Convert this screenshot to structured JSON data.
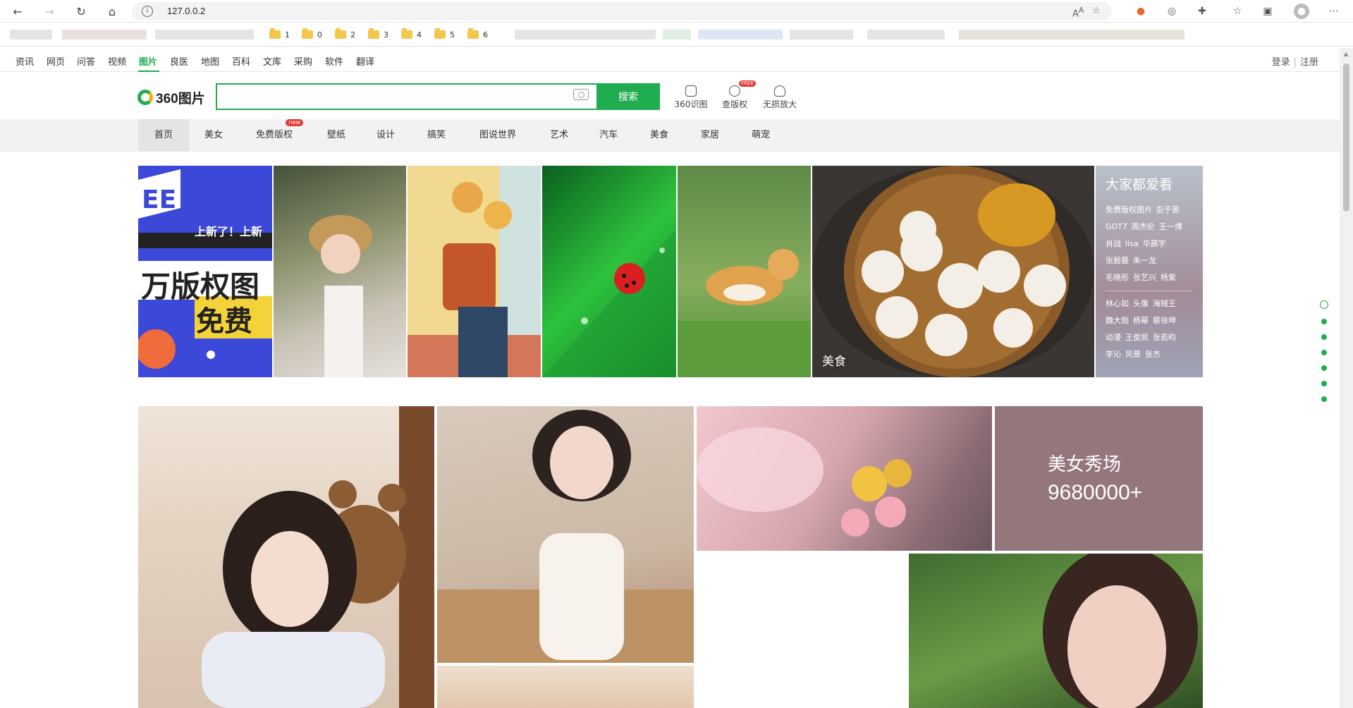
{
  "browser": {
    "url": "127.0.0.2",
    "bookmark_folders": [
      "1",
      "0",
      "2",
      "3",
      "4",
      "5",
      "6"
    ]
  },
  "topnav": {
    "items": [
      "资讯",
      "网页",
      "问答",
      "视频",
      "图片",
      "良医",
      "地图",
      "百科",
      "文库",
      "采购",
      "软件",
      "翻译"
    ],
    "active": "图片",
    "login": "登录",
    "register": "注册"
  },
  "search": {
    "logo_text": "360图片",
    "value": "",
    "button": "搜索",
    "tools": [
      {
        "label": "360识图",
        "icon": "image-search-icon"
      },
      {
        "label": "查版权",
        "icon": "copyright-search-icon",
        "badge": "FREE"
      },
      {
        "label": "无损放大",
        "icon": "upscale-icon"
      }
    ]
  },
  "categories": {
    "items": [
      "首页",
      "美女",
      "免费版权",
      "壁纸",
      "设计",
      "搞笑",
      "图说世界",
      "艺术",
      "汽车",
      "美食",
      "家居",
      "萌宠"
    ],
    "active": "首页",
    "new_badge": "new"
  },
  "banner": {
    "promo_lines": [
      "上新了！上新",
      "万版权图",
      "免费"
    ],
    "food_label": "美食",
    "side_title": "大家都爱看",
    "side_group1": [
      [
        "免费版权图片",
        "彭于晏"
      ],
      [
        "GOT7",
        "周杰伦",
        "王一博"
      ],
      [
        "肖战",
        "lisa",
        "华晨宇"
      ],
      [
        "张碧晨",
        "朱一龙"
      ],
      [
        "毛晓彤",
        "张艺兴",
        "杨紫"
      ]
    ],
    "side_group2": [
      [
        "林心如",
        "头像",
        "海贼王"
      ],
      [
        "魏大勋",
        "杨幂",
        "蔡徐坤"
      ],
      [
        "动漫",
        "王俊凯",
        "张若昀"
      ],
      [
        "李沁",
        "风景",
        "张杰"
      ]
    ]
  },
  "gallery": {
    "promo_title": "美女秀场",
    "promo_count": "9680000+"
  }
}
